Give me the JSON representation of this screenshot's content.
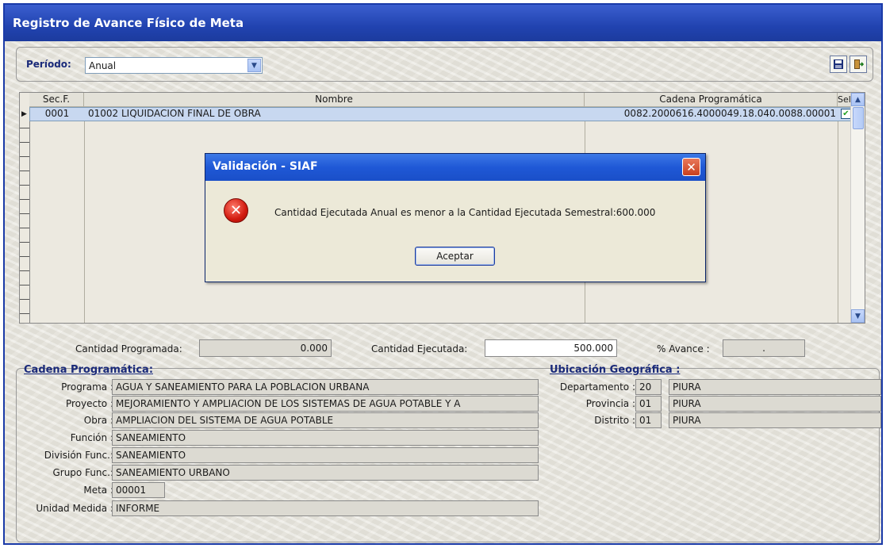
{
  "window": {
    "title": "Registro de Avance Físico de Meta"
  },
  "toolbar": {
    "periodo_label": "Período:",
    "periodo_value": "Anual",
    "save_icon": "save-icon",
    "exit_icon": "exit-icon"
  },
  "grid": {
    "headers": {
      "sec": "Sec.F.",
      "nombre": "Nombre",
      "cadena": "Cadena Programática",
      "sel": "Sel."
    },
    "rows": [
      {
        "sec": "0001",
        "nombre": "01002 LIQUIDACION FINAL DE OBRA",
        "cadena": "0082.2000616.4000049.18.040.0088.00001",
        "sel": true
      }
    ]
  },
  "cantidades": {
    "programada_label": "Cantidad Programada:",
    "programada_value": "0.000",
    "ejecutada_label": "Cantidad Ejecutada:",
    "ejecutada_value": "500.000",
    "avance_label": "% Avance :",
    "avance_value": "."
  },
  "cadena_programatica": {
    "title": "Cadena Programática:",
    "programa_label": "Programa :",
    "programa_value": "AGUA Y SANEAMIENTO PARA LA POBLACION URBANA",
    "proyecto_label": "Proyecto :",
    "proyecto_value": "MEJORAMIENTO Y AMPLIACION DE LOS SISTEMAS DE AGUA POTABLE Y A",
    "obra_label": "Obra :",
    "obra_value": "AMPLIACION DEL SISTEMA DE AGUA POTABLE",
    "funcion_label": "Función :",
    "funcion_value": "SANEAMIENTO",
    "division_label": "División Func.:",
    "division_value": "SANEAMIENTO",
    "grupo_label": "Grupo Func.:",
    "grupo_value": "SANEAMIENTO URBANO",
    "meta_label": "Meta :",
    "meta_value": "00001",
    "unidad_label": "Unidad Medida :",
    "unidad_value": "INFORME"
  },
  "ubicacion": {
    "title": "Ubicación Geográfica :",
    "departamento_label": "Departamento :",
    "departamento_code": "20",
    "departamento_name": "PIURA",
    "provincia_label": "Provincia :",
    "provincia_code": "01",
    "provincia_name": "PIURA",
    "distrito_label": "Distrito :",
    "distrito_code": "01",
    "distrito_name": "PIURA"
  },
  "dialog": {
    "title": "Validación - SIAF",
    "message": "Cantidad Ejecutada Anual es menor a la Cantidad Ejecutada Semestral:600.000",
    "ok_label": "Aceptar",
    "icon": "error-icon"
  }
}
